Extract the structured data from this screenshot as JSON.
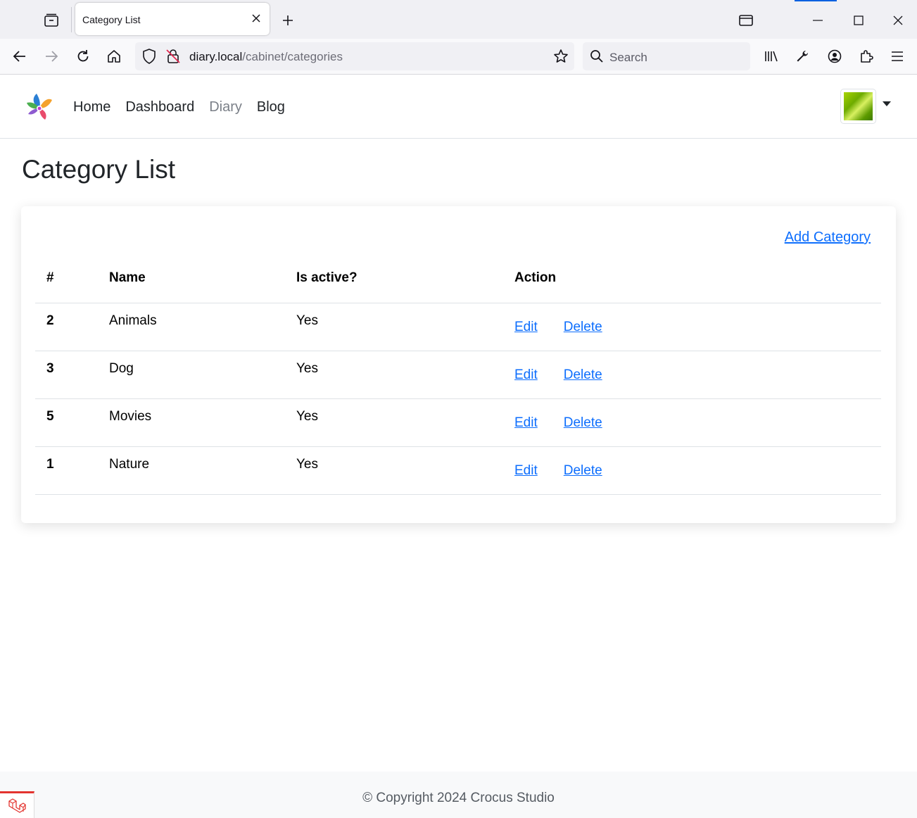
{
  "browser": {
    "tab_title": "Category List",
    "url_host": "diary.local",
    "url_path": "/cabinet/categories",
    "search_placeholder": "Search"
  },
  "nav": {
    "links": [
      "Home",
      "Dashboard",
      "Diary",
      "Blog"
    ]
  },
  "page": {
    "title": "Category List",
    "add_label": "Add Category"
  },
  "table": {
    "headers": [
      "#",
      "Name",
      "Is active?",
      "Action"
    ],
    "rows": [
      {
        "id": "2",
        "name": "Animals",
        "active": "Yes",
        "edit": "Edit",
        "delete": "Delete"
      },
      {
        "id": "3",
        "name": "Dog",
        "active": "Yes",
        "edit": "Edit",
        "delete": "Delete"
      },
      {
        "id": "5",
        "name": "Movies",
        "active": "Yes",
        "edit": "Edit",
        "delete": "Delete"
      },
      {
        "id": "1",
        "name": "Nature",
        "active": "Yes",
        "edit": "Edit",
        "delete": "Delete"
      }
    ]
  },
  "footer": {
    "copyright": "© Copyright 2024 Crocus Studio"
  },
  "colors": {
    "link": "#0d6efd",
    "chrome_accent": "#0061e0"
  }
}
